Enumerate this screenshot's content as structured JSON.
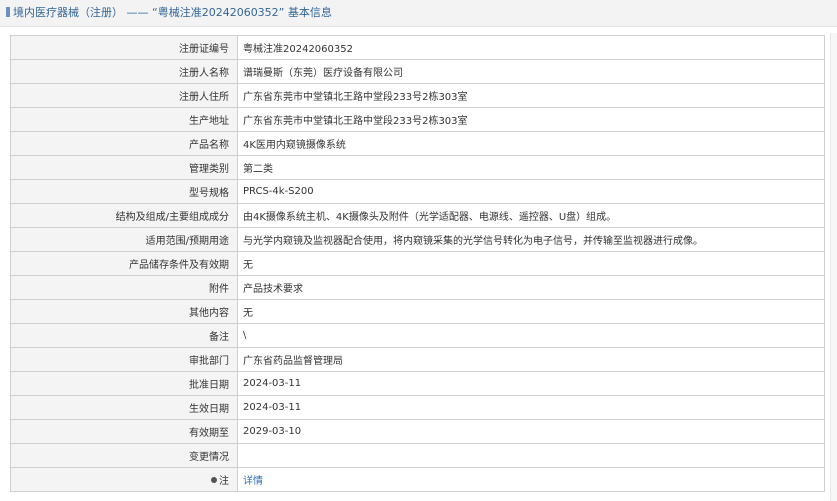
{
  "header": {
    "breadcrumb_root": "境内医疗器械（注册）",
    "separator": "——",
    "record_title": "“粤械注准20242060352”",
    "suffix": "基本信息"
  },
  "rows": [
    {
      "label": "注册证编号",
      "value": "粤械注准20242060352"
    },
    {
      "label": "注册人名称",
      "value": "谱瑞曼斯（东莞）医疗设备有限公司"
    },
    {
      "label": "注册人住所",
      "value": "广东省东莞市中堂镇北王路中堂段233号2栋303室"
    },
    {
      "label": "生产地址",
      "value": "广东省东莞市中堂镇北王路中堂段233号2栋303室"
    },
    {
      "label": "产品名称",
      "value": "4K医用内窥镜摄像系统"
    },
    {
      "label": "管理类别",
      "value": "第二类"
    },
    {
      "label": "型号规格",
      "value": "PRCS-4k-S200"
    },
    {
      "label": "结构及组成/主要组成成分",
      "value": "由4K摄像系统主机、4K摄像头及附件（光学适配器、电源线、遥控器、U盘）组成。"
    },
    {
      "label": "适用范围/预期用途",
      "value": "与光学内窥镜及监视器配合使用，将内窥镜采集的光学信号转化为电子信号，并传输至监视器进行成像。"
    },
    {
      "label": "产品储存条件及有效期",
      "value": "无"
    },
    {
      "label": "附件",
      "value": "产品技术要求"
    },
    {
      "label": "其他内容",
      "value": "无"
    },
    {
      "label": "备注",
      "value": "\\"
    },
    {
      "label": "审批部门",
      "value": "广东省药品监督管理局"
    },
    {
      "label": "批准日期",
      "value": "2024-03-11"
    },
    {
      "label": "生效日期",
      "value": "2024-03-11"
    },
    {
      "label": "有效期至",
      "value": "2029-03-10"
    },
    {
      "label": "变更情况",
      "value": ""
    },
    {
      "label": "注",
      "value": "详情"
    }
  ],
  "icons": {
    "header": "list-icon",
    "note": "pin-icon"
  },
  "colors": {
    "link": "#2f6fb5",
    "label_bg": "#f4f4f4",
    "border": "#cfcfcf",
    "header_text": "#336699"
  }
}
